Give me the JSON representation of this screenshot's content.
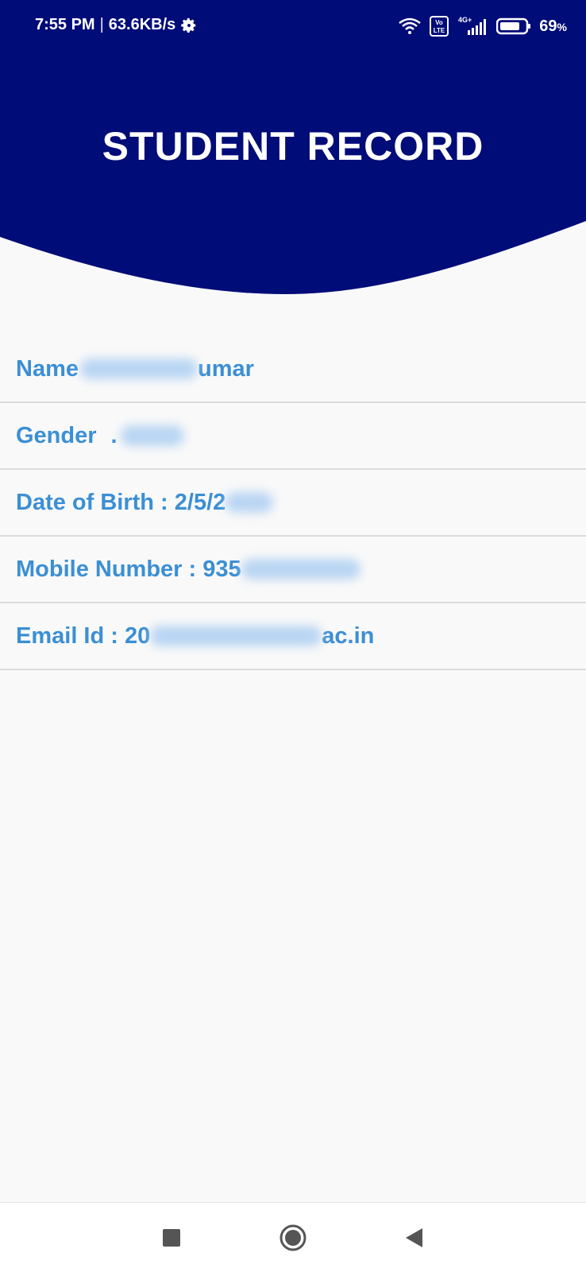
{
  "status_bar": {
    "time": "7:55 PM",
    "separator": "|",
    "network_speed": "63.6KB/s",
    "battery_level": "69",
    "battery_unit": "%",
    "network_type": "4G+",
    "volte_label": "Vo LTE",
    "icons": [
      "settings-gear-icon",
      "wifi-icon",
      "volte-icon",
      "signal-icon",
      "battery-icon"
    ]
  },
  "header": {
    "title": "STUDENT RECORD",
    "background_color": "#000c78"
  },
  "record": {
    "accent_color": "#3b8fd4",
    "rows": [
      {
        "label": "Name",
        "value_visible": "umar"
      },
      {
        "label": "Gender",
        "value_visible": "."
      },
      {
        "label": "Date of Birth",
        "separator": " : ",
        "value_visible": "2/5/2"
      },
      {
        "label": "Mobile Number",
        "separator": " : ",
        "value_visible": "935"
      },
      {
        "label": "Email Id",
        "separator": " : ",
        "value_visible": "20",
        "value_suffix": "ac.in"
      }
    ]
  },
  "nav_bar": {
    "buttons": [
      "recents-square-icon",
      "home-circle-icon",
      "back-triangle-icon"
    ]
  }
}
